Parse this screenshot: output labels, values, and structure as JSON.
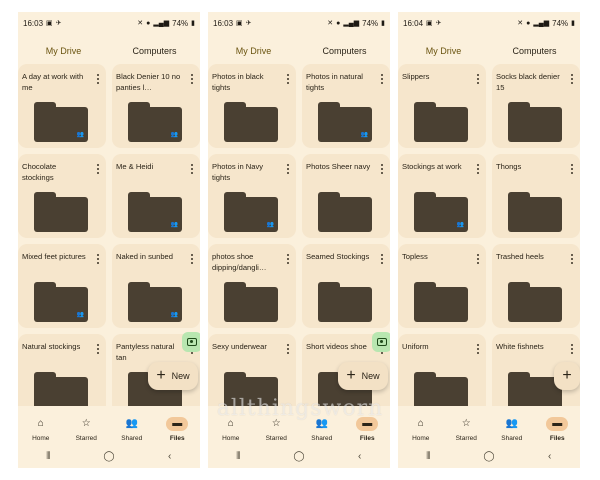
{
  "colors": {
    "background": "#fbf0dc",
    "card": "#f6e6cc",
    "folder": "#4a4032",
    "accent": "#8a6d18",
    "active_nav": "#f2c89a",
    "scan_fab": "#b8e6b0"
  },
  "tabs": [
    "My Drive",
    "Computers"
  ],
  "nav": [
    "Home",
    "Starred",
    "Shared",
    "Files"
  ],
  "new_label": "New",
  "watermark": "allthingsworn",
  "screens": [
    {
      "status": {
        "time": "16:03",
        "battery": "74%"
      },
      "folders": [
        {
          "name": "A day at work with me",
          "shared": true
        },
        {
          "name": "Black Denier 10 no panties l…",
          "shared": true
        },
        {
          "name": "Chocolate stockings",
          "shared": false
        },
        {
          "name": "Me & Heidi",
          "shared": true
        },
        {
          "name": "Mixed feet pictures",
          "shared": true
        },
        {
          "name": "Naked in sunbed",
          "shared": true
        },
        {
          "name": "Natural stockings",
          "shared": false
        },
        {
          "name": "Pantyless natural tan",
          "shared": false
        }
      ]
    },
    {
      "status": {
        "time": "16:03",
        "battery": "74%"
      },
      "folders": [
        {
          "name": "Photos in black tights",
          "shared": false
        },
        {
          "name": "Photos in natural tights",
          "shared": true
        },
        {
          "name": "Photos in Navy tights",
          "shared": true
        },
        {
          "name": "Photos Sheer navy",
          "shared": false
        },
        {
          "name": "photos shoe dipping/dangli…",
          "shared": false
        },
        {
          "name": "Seamed Stockings",
          "shared": false
        },
        {
          "name": "Sexy underwear",
          "shared": false
        },
        {
          "name": "Short videos shoe",
          "shared": false
        }
      ]
    },
    {
      "status": {
        "time": "16:04",
        "battery": "74%"
      },
      "folders": [
        {
          "name": "Slippers",
          "shared": false
        },
        {
          "name": "Socks black denier 15",
          "shared": false
        },
        {
          "name": "Stockings at work",
          "shared": true
        },
        {
          "name": "Thongs",
          "shared": false
        },
        {
          "name": "Topless",
          "shared": false
        },
        {
          "name": "Trashed heels",
          "shared": false
        },
        {
          "name": "Uniform",
          "shared": false
        },
        {
          "name": "White fishnets",
          "shared": false
        }
      ]
    }
  ]
}
